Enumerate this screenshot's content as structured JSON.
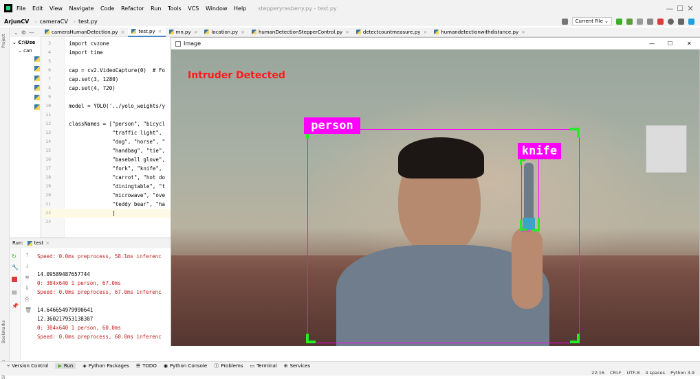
{
  "titlebar": {
    "menu": [
      "File",
      "Edit",
      "View",
      "Navigate",
      "Code",
      "Refactor",
      "Run",
      "Tools",
      "VCS",
      "Window",
      "Help"
    ],
    "window_title": "stepperyrasbeny.py - test.py",
    "minimize": "—",
    "maximize": "☐",
    "close": "✕"
  },
  "navbar": {
    "project": "ArjunCV",
    "folder": "cameraCV",
    "file": "test.py",
    "run_config": "Current File ⌄"
  },
  "tabs": [
    {
      "label": "cameraHumanDetection.py"
    },
    {
      "label": "test.py"
    },
    {
      "label": "mn.py"
    },
    {
      "label": "location.py"
    },
    {
      "label": "humanDetectionStepperControl.py"
    },
    {
      "label": "detectcountmeasure.py"
    },
    {
      "label": "humandetectionwithdistance.py"
    }
  ],
  "project": {
    "root": "C:\\Use",
    "sub": "can",
    "strip_label": "Project"
  },
  "editor": {
    "lines": [
      {
        "n": "3",
        "code": "import cvzone"
      },
      {
        "n": "4",
        "code": "import time"
      },
      {
        "n": "5",
        "code": ""
      },
      {
        "n": "6",
        "code": "cap = cv2.VideoCapture(0)  # Fo"
      },
      {
        "n": "7",
        "code": "cap.set(3, 1280)"
      },
      {
        "n": "8",
        "code": "cap.set(4, 720)"
      },
      {
        "n": "9",
        "code": ""
      },
      {
        "n": "10",
        "code": "model = YOLO('../yolo_weights/y"
      },
      {
        "n": "11",
        "code": ""
      },
      {
        "n": "12",
        "code": "classNames = [\"person\", \"bicycl"
      },
      {
        "n": "13",
        "code": "              \"traffic light\","
      },
      {
        "n": "14",
        "code": "              \"dog\", \"horse\", \""
      },
      {
        "n": "15",
        "code": "              \"handbag\", \"tie\","
      },
      {
        "n": "16",
        "code": "              \"baseball glove\","
      },
      {
        "n": "17",
        "code": "              \"fork\", \"knife\","
      },
      {
        "n": "18",
        "code": "              \"carrot\", \"hot do"
      },
      {
        "n": "19",
        "code": "              \"diningtable\", \"t"
      },
      {
        "n": "20",
        "code": "              \"microwave\", \"ove"
      },
      {
        "n": "21",
        "code": "              \"teddy bear\", \"ha"
      },
      {
        "n": "22",
        "code": "              ]"
      },
      {
        "n": "23",
        "code": ""
      }
    ]
  },
  "run": {
    "label": "Run:",
    "config": "test",
    "console": [
      {
        "text": "Speed: 0.0ms preprocess, 58.1ms inferenc",
        "type": "err"
      },
      {
        "text": "",
        "type": "out"
      },
      {
        "text": "14.09589487657744",
        "type": "out"
      },
      {
        "text": "0: 384x640 1 person, 67.0ms",
        "type": "err"
      },
      {
        "text": "Speed: 0.0ms preprocess, 67.0ms inferenc",
        "type": "err"
      },
      {
        "text": "",
        "type": "out"
      },
      {
        "text": "14.646654979990641",
        "type": "out"
      },
      {
        "text": "12.360217953138307",
        "type": "out"
      },
      {
        "text": "0: 384x640 1 person, 60.0ms",
        "type": "err"
      },
      {
        "text": "Speed: 0.0ms preprocess, 60.0ms inferenc",
        "type": "err"
      }
    ],
    "strip_bookmarks": "Bookmarks",
    "strip_structure": "Structure"
  },
  "image_window": {
    "title": "Image",
    "alert": "Intruder Detected",
    "detections": [
      {
        "label": "person"
      },
      {
        "label": "knife"
      }
    ]
  },
  "status_tools": [
    "Version Control",
    "Run",
    "Python Packages",
    "TODO",
    "Python Console",
    "Problems",
    "Terminal",
    "Services"
  ],
  "statusbar": {
    "position": "22:16",
    "line_sep": "CRLF",
    "encoding": "UTF-8",
    "indent": "4 spaces",
    "interpreter": "Python 3.9"
  },
  "colors": {
    "box": "#ff00ff",
    "corner": "#22ee22",
    "alert": "#ff1a1a"
  }
}
